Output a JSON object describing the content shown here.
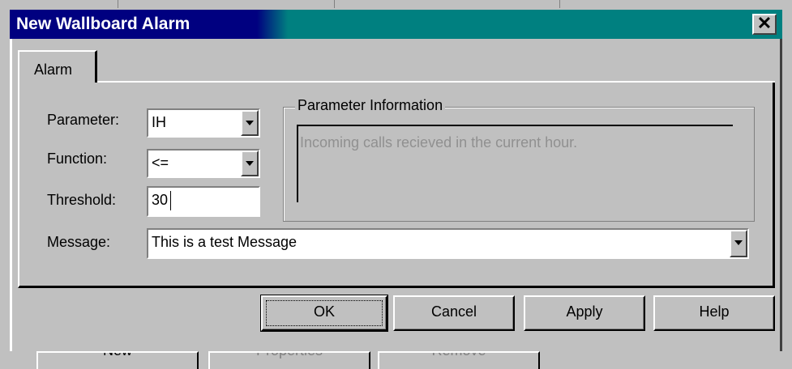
{
  "dialog": {
    "title": "New Wallboard Alarm",
    "close_glyph": "✕"
  },
  "tabs": [
    {
      "label": "Alarm"
    }
  ],
  "form": {
    "parameter": {
      "label": "Parameter:",
      "value": "IH"
    },
    "function": {
      "label": "Function:",
      "value": "<="
    },
    "threshold": {
      "label": "Threshold:",
      "value": "30"
    },
    "message": {
      "label": "Message:",
      "value": "This is a test Message"
    }
  },
  "parameter_info": {
    "group_title": "Parameter Information",
    "text": "Incoming calls recieved in the current hour."
  },
  "buttons": {
    "ok": "OK",
    "cancel": "Cancel",
    "apply": "Apply",
    "help": "Help"
  },
  "background_window": {
    "buttons": [
      "New",
      "Properties",
      "Remove"
    ]
  },
  "colors": {
    "title_active": "#000080",
    "title_gradient_end": "#008080",
    "face": "#c0c0c0",
    "disabled_text": "#909090"
  }
}
